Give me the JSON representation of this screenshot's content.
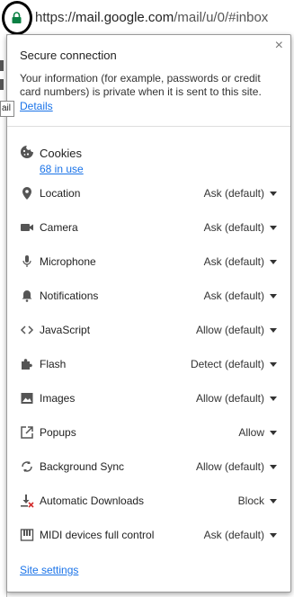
{
  "address_bar": {
    "scheme": "https://",
    "host": "mail.google.com",
    "path": "/mail/u/0/#inbox"
  },
  "background": {
    "tooltip_text": "ail"
  },
  "popup": {
    "close_symbol": "×",
    "connection": {
      "title": "Secure connection",
      "description": "Your information (for example, passwords or credit card numbers) is private when it is sent to this site.",
      "details_link": "Details"
    },
    "cookies": {
      "title": "Cookies",
      "in_use": "68 in use"
    },
    "permissions": [
      {
        "name": "Location",
        "value": "Ask (default)",
        "icon": "location-icon"
      },
      {
        "name": "Camera",
        "value": "Ask (default)",
        "icon": "camera-icon"
      },
      {
        "name": "Microphone",
        "value": "Ask (default)",
        "icon": "microphone-icon"
      },
      {
        "name": "Notifications",
        "value": "Ask (default)",
        "icon": "bell-icon"
      },
      {
        "name": "JavaScript",
        "value": "Allow (default)",
        "icon": "code-icon"
      },
      {
        "name": "Flash",
        "value": "Detect (default)",
        "icon": "puzzle-icon"
      },
      {
        "name": "Images",
        "value": "Allow (default)",
        "icon": "image-icon"
      },
      {
        "name": "Popups",
        "value": "Allow",
        "icon": "popup-icon"
      },
      {
        "name": "Background Sync",
        "value": "Allow (default)",
        "icon": "sync-icon"
      },
      {
        "name": "Automatic Downloads",
        "value": "Block",
        "icon": "download-icon"
      },
      {
        "name": "MIDI devices full control",
        "value": "Ask (default)",
        "icon": "piano-icon"
      }
    ],
    "site_settings_link": "Site settings"
  },
  "colors": {
    "lock_green": "#0b8043",
    "link_blue": "#1a73e8"
  }
}
